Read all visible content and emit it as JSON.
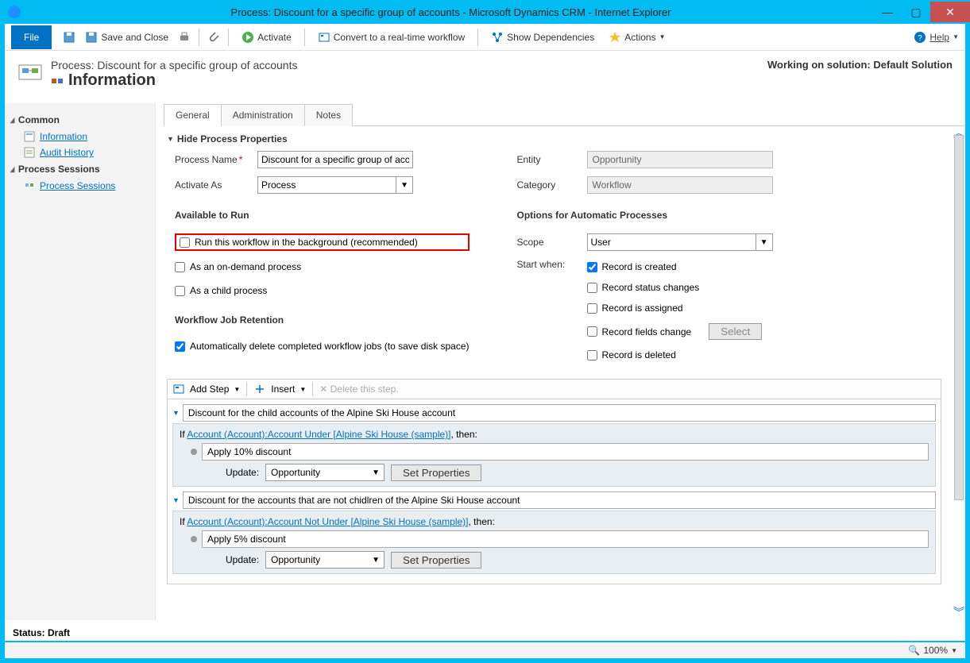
{
  "window": {
    "title": "Process: Discount for a specific group of accounts - Microsoft Dynamics CRM - Internet Explorer"
  },
  "toolbar": {
    "file": "File",
    "save_close": "Save and Close",
    "activate": "Activate",
    "convert": "Convert to a real-time workflow",
    "show_deps": "Show Dependencies",
    "actions": "Actions",
    "help": "Help"
  },
  "header": {
    "crumb": "Process: Discount for a specific group of accounts",
    "title": "Information",
    "working_on": "Working on solution: Default Solution"
  },
  "nav": {
    "common": "Common",
    "information": "Information",
    "audit": "Audit History",
    "sessions_hdr": "Process Sessions",
    "sessions": "Process Sessions"
  },
  "tabs": {
    "general": "General",
    "admin": "Administration",
    "notes": "Notes"
  },
  "form": {
    "toggle": "Hide Process Properties",
    "process_name_label": "Process Name",
    "process_name_value": "Discount for a specific group of accounts",
    "activate_as_label": "Activate As",
    "activate_as_value": "Process",
    "entity_label": "Entity",
    "entity_value": "Opportunity",
    "category_label": "Category",
    "category_value": "Workflow",
    "avail_hdr": "Available to Run",
    "run_bg": "Run this workflow in the background (recommended)",
    "on_demand": "As an on-demand process",
    "child_proc": "As a child process",
    "retention_hdr": "Workflow Job Retention",
    "auto_delete": "Automatically delete completed workflow jobs (to save disk space)",
    "opts_hdr": "Options for Automatic Processes",
    "scope_label": "Scope",
    "scope_value": "User",
    "start_when": "Start when:",
    "rec_created": "Record is created",
    "rec_status": "Record status changes",
    "rec_assigned": "Record is assigned",
    "rec_fields": "Record fields change",
    "select_btn": "Select",
    "rec_deleted": "Record is deleted"
  },
  "steps": {
    "add_step": "Add Step",
    "insert": "Insert",
    "delete": "Delete this step.",
    "stage1_title": "Discount for the child accounts of the Alpine Ski House account",
    "stage1_if_prefix": "If ",
    "stage1_cond": "Account (Account):Account Under [Alpine Ski House (sample)]",
    "then": ", then:",
    "stage1_step": "Apply 10% discount",
    "update_label": "Update:",
    "update_value": "Opportunity",
    "set_props": "Set Properties",
    "stage2_title": "Discount for the accounts that are not chidlren of the Alpine Ski House account",
    "stage2_cond": "Account (Account):Account Not Under [Alpine Ski House (sample)]",
    "stage2_step": "Apply 5% discount"
  },
  "status": {
    "label": "Status:",
    "value": "Draft"
  },
  "ie": {
    "zoom": "100%"
  }
}
